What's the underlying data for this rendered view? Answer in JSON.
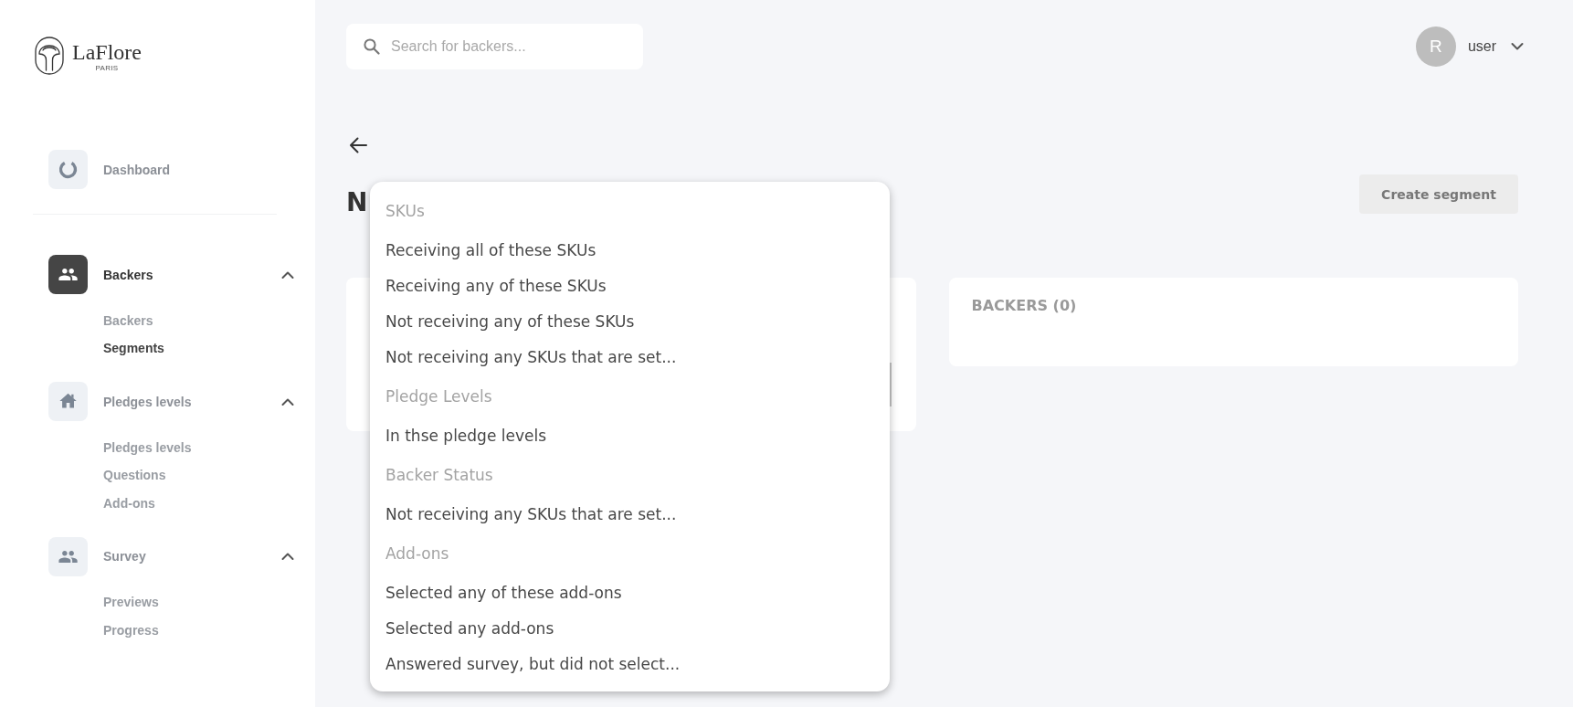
{
  "sidebar": {
    "logo": {
      "name": "LaFlore",
      "tagline": "PARIS"
    },
    "items": [
      {
        "kind": "link",
        "label": "Dashboard",
        "selected": false
      },
      {
        "kind": "group",
        "label": "Backers",
        "selected": true,
        "expanded": true,
        "children": [
          {
            "label": "Backers",
            "selected": false
          },
          {
            "label": "Segments",
            "selected": true
          }
        ]
      },
      {
        "kind": "group",
        "label": "Pledges levels",
        "selected": false,
        "expanded": true,
        "children": [
          {
            "label": "Pledges levels",
            "selected": false
          },
          {
            "label": "Questions",
            "selected": false
          },
          {
            "label": "Add-ons",
            "selected": false
          }
        ]
      },
      {
        "kind": "group",
        "label": "Survey",
        "selected": false,
        "expanded": true,
        "children": [
          {
            "label": "Previews",
            "selected": false
          },
          {
            "label": "Progress",
            "selected": false
          }
        ]
      }
    ]
  },
  "topbar": {
    "search": {
      "placeholder": "Search for backers..."
    },
    "user": {
      "avatar_initial": "R",
      "name": "user"
    }
  },
  "page": {
    "title": "N",
    "create_button": "Create segment"
  },
  "backers_panel": {
    "title": "BACKERS (0)"
  },
  "dropdown": {
    "groups": [
      {
        "header": "SKUs",
        "options": [
          {
            "label": "Receiving all of these SKUs",
            "selected": false
          },
          {
            "label": "Receiving any of these SKUs",
            "selected": false
          },
          {
            "label": "Not receiving any of these SKUs",
            "selected": false
          },
          {
            "label": "Not receiving any SKUs that are set...",
            "selected": false
          }
        ]
      },
      {
        "header": "Pledge Levels",
        "options": [
          {
            "label": "In thse pledge levels",
            "selected": false
          }
        ]
      },
      {
        "header": "Backer Status",
        "options": [
          {
            "label": "Not receiving any SKUs that are set...",
            "selected": false
          }
        ]
      },
      {
        "header": "Add-ons",
        "options": [
          {
            "label": "Selected any of these add-ons",
            "selected": false
          },
          {
            "label": "Selected any add-ons",
            "selected": false
          },
          {
            "label": "Answered survey, but did not select...",
            "selected": false
          }
        ]
      }
    ]
  }
}
